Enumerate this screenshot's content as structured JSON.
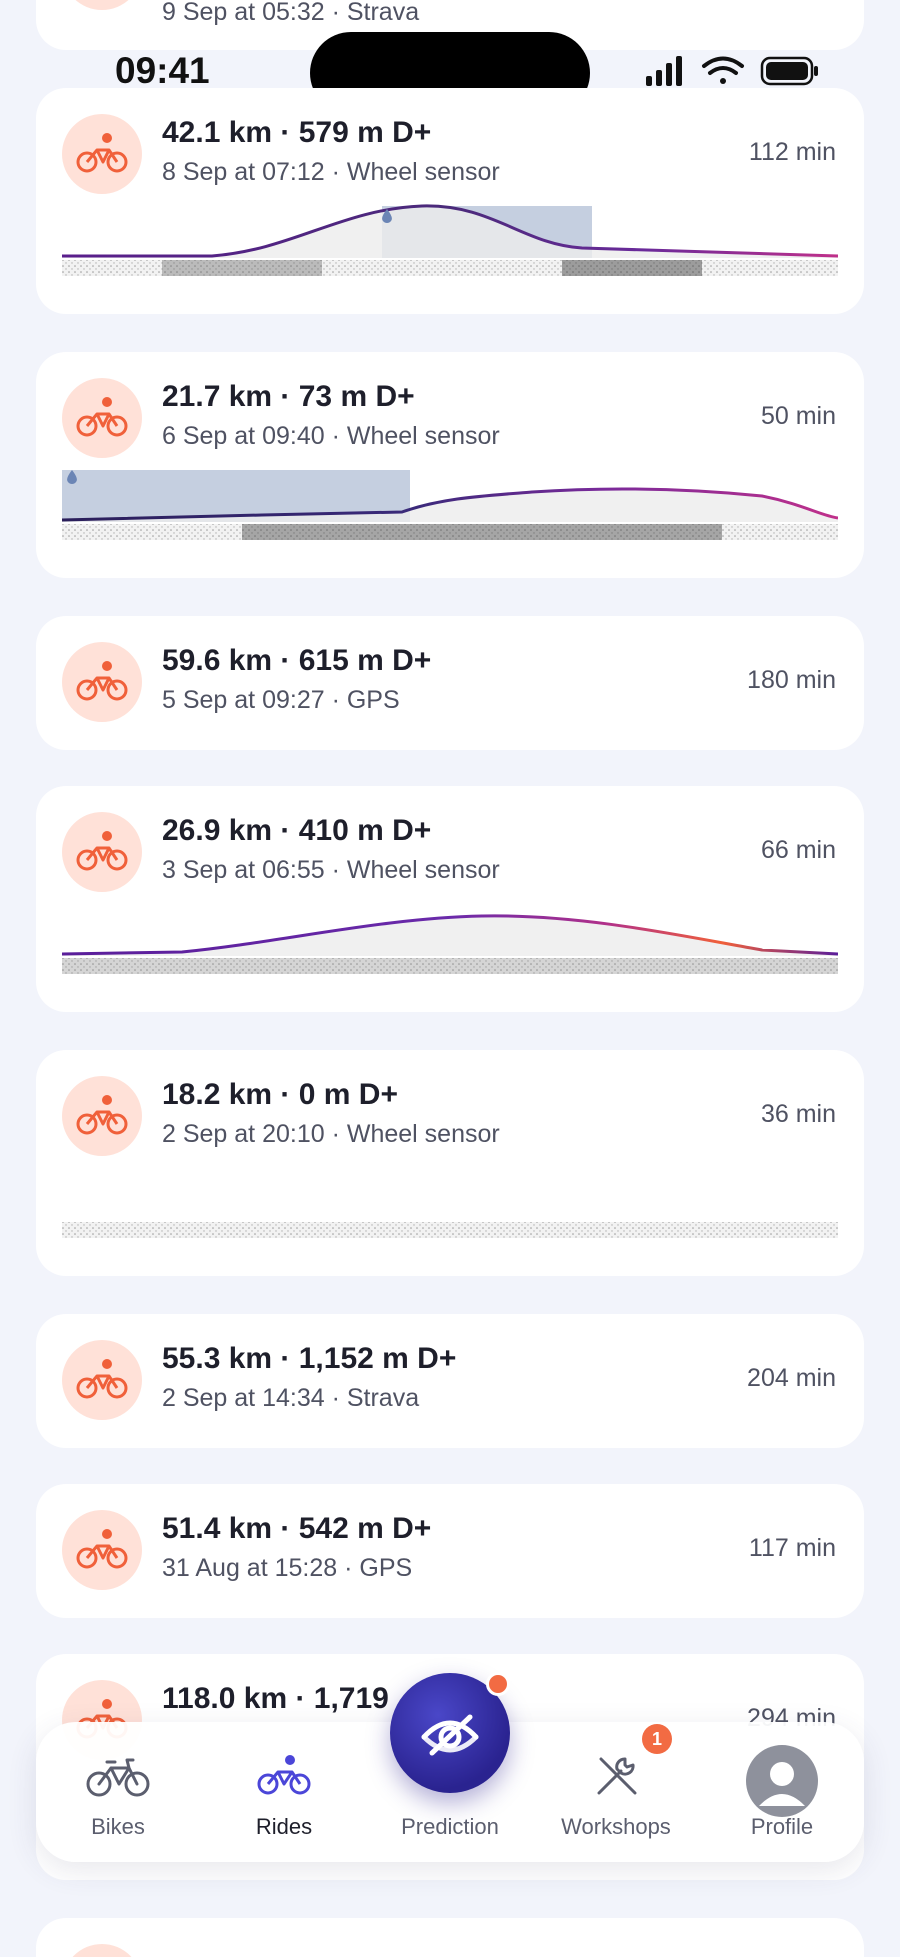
{
  "status_bar": {
    "time": "09:41"
  },
  "colors": {
    "accent_indigo": "#2a2390",
    "ride_icon_bg": "#ffe1d8",
    "ride_icon_fg": "#f0603a",
    "badge": "#f26b43",
    "rain_band": "#c5cfe0"
  },
  "rides": [
    {
      "title": "",
      "subtitle": "9 Sep at 05:32 · Strava",
      "duration": ""
    },
    {
      "title": "42.1 km · 579 m D+",
      "subtitle": "8 Sep at 07:12 · Wheel sensor",
      "duration": "112 min"
    },
    {
      "title": "21.7 km · 73 m D+",
      "subtitle": "6 Sep at 09:40 · Wheel sensor",
      "duration": "50 min"
    },
    {
      "title": "59.6 km · 615 m D+",
      "subtitle": "5 Sep at 09:27 · GPS",
      "duration": "180 min"
    },
    {
      "title": "26.9 km · 410 m D+",
      "subtitle": "3 Sep at 06:55 · Wheel sensor",
      "duration": "66 min"
    },
    {
      "title": "18.2 km · 0 m D+",
      "subtitle": "2 Sep at 20:10 · Wheel sensor",
      "duration": "36 min"
    },
    {
      "title": "55.3 km · 1,152 m D+",
      "subtitle": "2 Sep at 14:34 · Strava",
      "duration": "204 min"
    },
    {
      "title": "51.4 km · 542 m D+",
      "subtitle": "31 Aug at 15:28 · GPS",
      "duration": "117 min"
    },
    {
      "title": "118.0 km · 1,719",
      "subtitle": "",
      "duration": "294 min"
    }
  ],
  "tabs": {
    "bikes": "Bikes",
    "rides": "Rides",
    "prediction": "Prediction",
    "workshops": "Workshops",
    "workshops_badge": "1",
    "profile": "Profile"
  },
  "icons": {
    "ride": "bicycle-rider-icon",
    "rain": "raindrop-icon",
    "bikes_tab": "bicycle-icon",
    "rides_tab": "cyclist-icon",
    "prediction": "prediction-icon",
    "workshops": "tools-icon",
    "profile": "avatar-icon"
  }
}
